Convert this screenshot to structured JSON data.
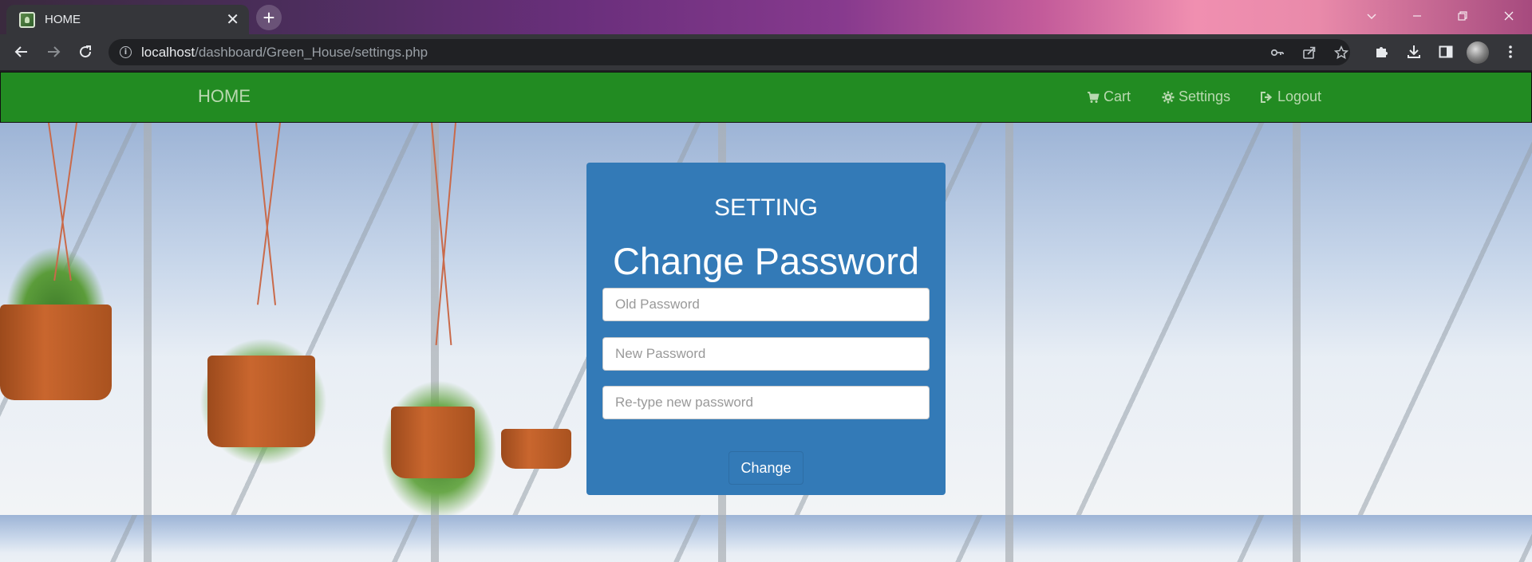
{
  "browser": {
    "tab_title": "HOME",
    "url_host": "localhost",
    "url_path": "/dashboard/Green_House/settings.php",
    "icons": {
      "favicon": "greenhouse-favicon",
      "tab_close": "close-icon",
      "new_tab": "plus-icon",
      "back": "back-arrow-icon",
      "forward": "forward-arrow-icon",
      "reload": "reload-icon",
      "site_info": "info-icon",
      "password": "key-icon",
      "share": "share-icon",
      "bookmark": "star-icon",
      "extensions": "puzzle-icon",
      "downloads": "download-icon",
      "side_panel": "side-panel-icon",
      "menu": "kebab-menu-icon"
    }
  },
  "navbar": {
    "brand": "HOME",
    "links": [
      {
        "label": "Cart",
        "icon": "cart-icon"
      },
      {
        "label": "Settings",
        "icon": "gear-icon"
      },
      {
        "label": "Logout",
        "icon": "logout-icon"
      }
    ],
    "background_color": "#228b22",
    "text_color": "#b9d9b0"
  },
  "card": {
    "heading": "SETTING",
    "title": "Change Password",
    "fields": {
      "old_password": {
        "placeholder": "Old Password",
        "value": ""
      },
      "new_password": {
        "placeholder": "New Password",
        "value": ""
      },
      "retype_password": {
        "placeholder": "Re-type new password",
        "value": ""
      }
    },
    "submit_label": "Change",
    "background_color": "#337ab7"
  }
}
